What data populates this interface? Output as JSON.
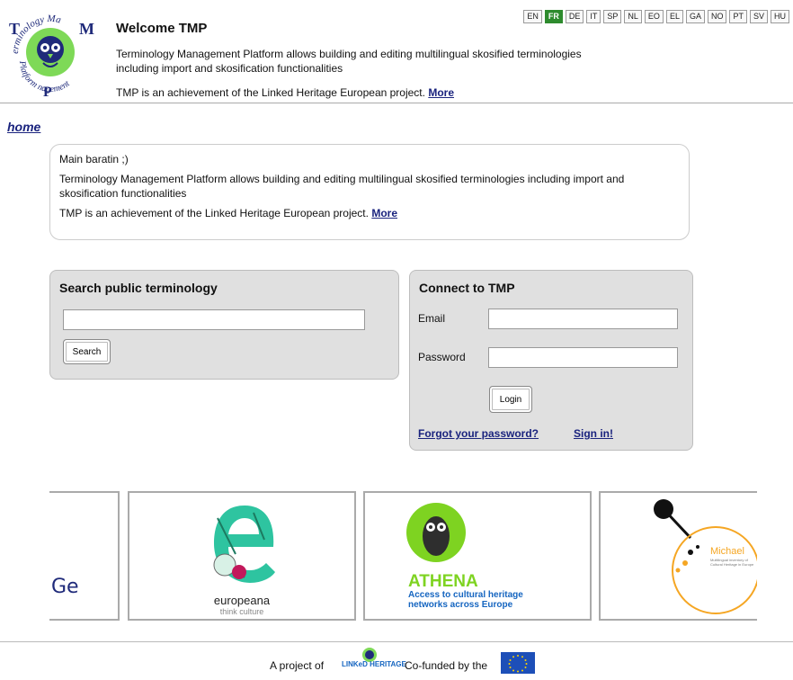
{
  "header": {
    "logo_text": "Terminology Management Platform",
    "title": "Welcome TMP",
    "description": "Terminology Management Platform allows building and editing multilingual skosified terminologies including import and skosification functionalities",
    "project_text": "TMP is an achievement of the Linked Heritage European project.",
    "more_link": "More"
  },
  "languages": [
    {
      "code": "EN",
      "active": false
    },
    {
      "code": "FR",
      "active": true
    },
    {
      "code": "DE",
      "active": false
    },
    {
      "code": "IT",
      "active": false
    },
    {
      "code": "SP",
      "active": false
    },
    {
      "code": "NL",
      "active": false
    },
    {
      "code": "EO",
      "active": false
    },
    {
      "code": "EL",
      "active": false
    },
    {
      "code": "GA",
      "active": false
    },
    {
      "code": "NO",
      "active": false
    },
    {
      "code": "PT",
      "active": false
    },
    {
      "code": "SV",
      "active": false
    },
    {
      "code": "HU",
      "active": false
    }
  ],
  "breadcrumb": {
    "home": "home"
  },
  "main": {
    "heading": "Main baratin ;)",
    "description": "Terminology Management Platform allows building and editing multilingual skosified terminologies including import and skosification functionalities",
    "project_text": "TMP is an achievement of the Linked Heritage European project.",
    "more_link": "More"
  },
  "search": {
    "title": "Search public terminology",
    "input_value": "",
    "button_label": "Search"
  },
  "login": {
    "title": "Connect to TMP",
    "email_label": "Email",
    "email_value": "",
    "password_label": "Password",
    "password_value": "",
    "button_label": "Login",
    "forgot_link": "Forgot your password?",
    "signin_link": "Sign in!"
  },
  "partners": {
    "first_fragment": "Ge",
    "europeana_name": "europeana",
    "europeana_tagline": "think culture",
    "athena_name": "ATHENA",
    "athena_tagline_1": "Access to cultural heritage",
    "athena_tagline_2": "networks across Europe",
    "michael_name": "Michael",
    "michael_tagline": "Multilingual inventory of Cultural Heritage in Europe"
  },
  "footer": {
    "project_of": "A project of",
    "linked_logo": "LINKeD HERITAGE",
    "cofunded": "Co-funded by the"
  },
  "colors": {
    "accent_green": "#2e8b2e",
    "link_blue": "#1a237e",
    "panel_gray": "#e0e0e0",
    "logo_green": "#7ed957",
    "logo_navy": "#1f2a7a",
    "europeana_teal": "#2ec4a0",
    "athena_green": "#7ed321",
    "michael_orange": "#f5a623"
  },
  "icons": [
    "tmp-owl-logo-icon",
    "europeana-logo-icon",
    "athena-owl-icon",
    "michael-logo-icon",
    "linked-heritage-logo-icon",
    "eu-flag-icon"
  ]
}
